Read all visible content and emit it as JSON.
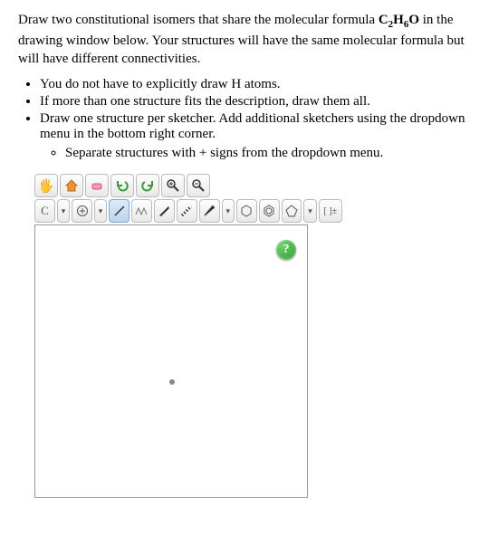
{
  "question": {
    "intro_a": "Draw two constitutional isomers that share the molecular formula ",
    "formula_parts": [
      "C",
      "2",
      "H",
      "6",
      "O"
    ],
    "intro_b": " in the drawing window below. Your structures will have the same molecular formula but will have different connectivities.",
    "bullets": [
      "You do not have to explicitly draw H atoms.",
      "If more than one structure fits the description, draw them all.",
      "Draw one structure per sketcher. Add additional sketchers using the dropdown menu in the bottom right corner."
    ],
    "sub_bullet": "Separate structures with + signs from the dropdown menu."
  },
  "toolbar": {
    "row1": {
      "move_icon": "✋",
      "home_icon": "⌂",
      "eraser_icon": "eraser",
      "undo_icon": "↶",
      "redo_icon": "↷",
      "zoom_in_icon": "zoom+",
      "zoom_out_icon": "zoom-"
    },
    "row2": {
      "atom_label": "C",
      "charge_label": "⊕",
      "single_bond": "single",
      "chain_bond": "chain",
      "wedge_bond": "wedge",
      "dash_bond": "dash",
      "hash_bond": "hash",
      "ring6": "hexagon",
      "benzene": "benzene",
      "ring5": "pentagon",
      "bracket_label": "[ ]±"
    }
  },
  "help": {
    "label": "?"
  }
}
